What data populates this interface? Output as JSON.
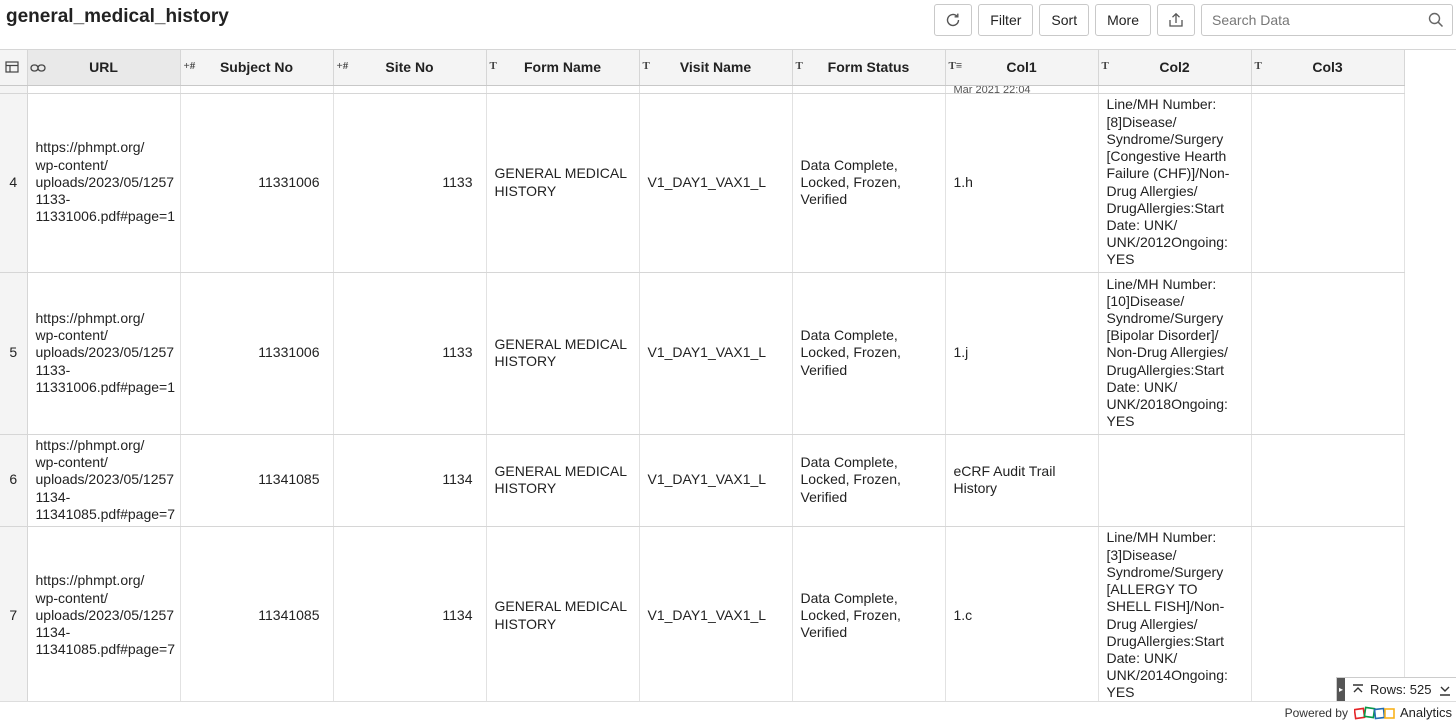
{
  "title": "general_medical_history",
  "toolbar": {
    "refresh_icon": "refresh-icon",
    "filter_label": "Filter",
    "sort_label": "Sort",
    "more_label": "More",
    "export_icon": "export-icon",
    "search_placeholder": "Search Data",
    "search_icon": "search-icon"
  },
  "columns": [
    {
      "label": "URL",
      "type_icon": "link-icon",
      "type_glyph": "⊖"
    },
    {
      "label": "Subject No",
      "type_icon": "number-icon",
      "type_glyph": "+#"
    },
    {
      "label": "Site No",
      "type_icon": "number-icon",
      "type_glyph": "+#"
    },
    {
      "label": "Form Name",
      "type_icon": "text-icon",
      "type_glyph": "T"
    },
    {
      "label": "Visit Name",
      "type_icon": "text-icon",
      "type_glyph": "T"
    },
    {
      "label": "Form Status",
      "type_icon": "text-icon",
      "type_glyph": "T"
    },
    {
      "label": "Col1",
      "type_icon": "multiline-text-icon",
      "type_glyph": "T≡"
    },
    {
      "label": "Col2",
      "type_icon": "text-icon",
      "type_glyph": "T"
    },
    {
      "label": "Col3",
      "type_icon": "text-icon",
      "type_glyph": "T"
    }
  ],
  "partial_row_text": "Mar 2021 22:04",
  "rows": [
    {
      "row_no": "4",
      "url": "https://phmpt.org/\nwp-content/\nuploads/2023/05/1257\n1133-\n11331006.pdf#page=1",
      "subject_no": "11331006",
      "site_no": "1133",
      "form_name": "GENERAL MEDICAL HISTORY",
      "visit_name": "V1_DAY1_VAX1_L",
      "form_status": "Data Complete, Locked, Frozen, Verified",
      "col1": "1.h",
      "col2": "Line/MH Number: [8]Disease/ Syndrome/Surgery [Congestive Hearth Failure (CHF)]/Non-Drug Allergies/ DrugAllergies:Start Date: UNK/ UNK/2012Ongoing: YES",
      "col3": ""
    },
    {
      "row_no": "5",
      "url": "https://phmpt.org/\nwp-content/\nuploads/2023/05/1257\n1133-\n11331006.pdf#page=1",
      "subject_no": "11331006",
      "site_no": "1133",
      "form_name": "GENERAL MEDICAL HISTORY",
      "visit_name": "V1_DAY1_VAX1_L",
      "form_status": "Data Complete, Locked, Frozen, Verified",
      "col1": "1.j",
      "col2": "Line/MH Number: [10]Disease/ Syndrome/Surgery [Bipolar Disorder]/ Non-Drug Allergies/ DrugAllergies:Start Date: UNK/ UNK/2018Ongoing: YES",
      "col3": ""
    },
    {
      "row_no": "6",
      "url": "https://phmpt.org/\nwp-content/\nuploads/2023/05/1257\n1134-\n11341085.pdf#page=7",
      "subject_no": "11341085",
      "site_no": "1134",
      "form_name": "GENERAL MEDICAL HISTORY",
      "visit_name": "V1_DAY1_VAX1_L",
      "form_status": "Data Complete, Locked, Frozen, Verified",
      "col1": "eCRF Audit Trail History",
      "col2": "",
      "col3": ""
    },
    {
      "row_no": "7",
      "url": "https://phmpt.org/\nwp-content/\nuploads/2023/05/1257\n1134-\n11341085.pdf#page=7",
      "subject_no": "11341085",
      "site_no": "1134",
      "form_name": "GENERAL MEDICAL HISTORY",
      "visit_name": "V1_DAY1_VAX1_L",
      "form_status": "Data Complete, Locked, Frozen, Verified",
      "col1": "1.c",
      "col2": "Line/MH Number: [3]Disease/ Syndrome/Surgery [ALLERGY TO SHELL FISH]/Non-Drug Allergies/ DrugAllergies:Start Date: UNK/ UNK/2014Ongoing: YES",
      "col3": ""
    }
  ],
  "rows_count": "Rows: 525",
  "footer": {
    "powered_by": "Powered by",
    "brand": "Analytics",
    "logo_icon": "zoho-logo-icon"
  },
  "colors": {
    "header_bg": "#f4f4f4",
    "border": "#d6d6d6",
    "logo_red": "#e42527",
    "logo_green": "#089949",
    "logo_blue": "#226db4",
    "logo_yellow": "#f9b21d"
  }
}
